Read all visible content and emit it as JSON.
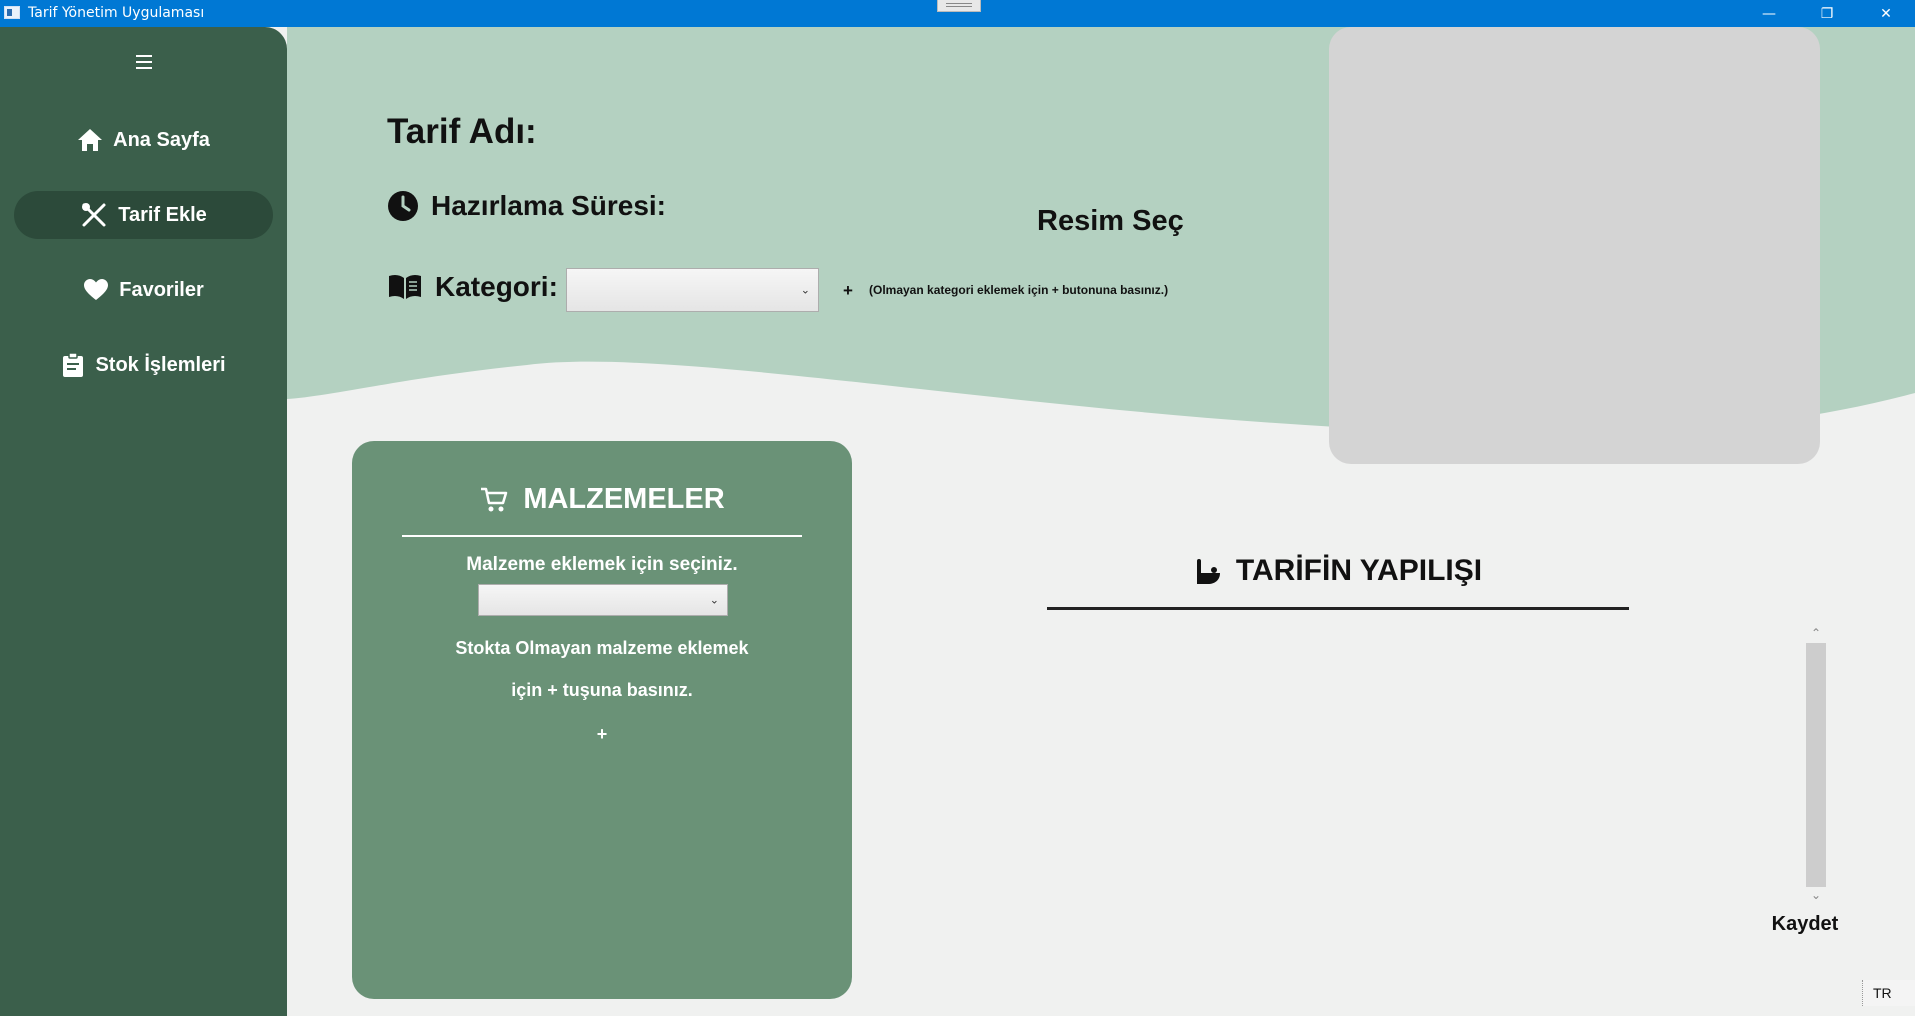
{
  "window": {
    "title": "Tarif Yönetim Uygulaması",
    "minimize": "—",
    "restore": "❐",
    "close": "✕"
  },
  "sidebar": {
    "items": [
      {
        "label": "Ana Sayfa",
        "icon": "home-icon"
      },
      {
        "label": "Tarif Ekle",
        "icon": "utensils-icon",
        "active": true
      },
      {
        "label": "Favoriler",
        "icon": "heart-icon"
      },
      {
        "label": "Stok İşlemleri",
        "icon": "clipboard-icon"
      }
    ]
  },
  "form": {
    "recipe_name_label": "Tarif Adı:",
    "prep_time_label": "Hazırlama Süresi:",
    "category_label": "Kategori:",
    "category_value": "",
    "add_category_button": "+",
    "add_category_hint": "(Olmayan kategori eklemek için + butonuna basınız.)",
    "image_select_label": "Resim Seç"
  },
  "ingredients": {
    "title": "MALZEMELER",
    "select_prompt": "Malzeme eklemek için seçiniz.",
    "select_value": "",
    "hint_line1": "Stokta Olmayan malzeme eklemek",
    "hint_line2": "için + tuşuna basınız.",
    "add_button": "+"
  },
  "steps": {
    "title": "TARİFİN YAPILIŞI"
  },
  "save_button": "Kaydet",
  "language_indicator": "TR",
  "colors": {
    "sidebar": "#3b5f4b",
    "sidebar_active": "#2c4a3a",
    "top_band": "#b4d1c1",
    "ingredients_card": "#6a9277",
    "image_panel": "#d4d4d4",
    "titlebar": "#0078d4"
  }
}
